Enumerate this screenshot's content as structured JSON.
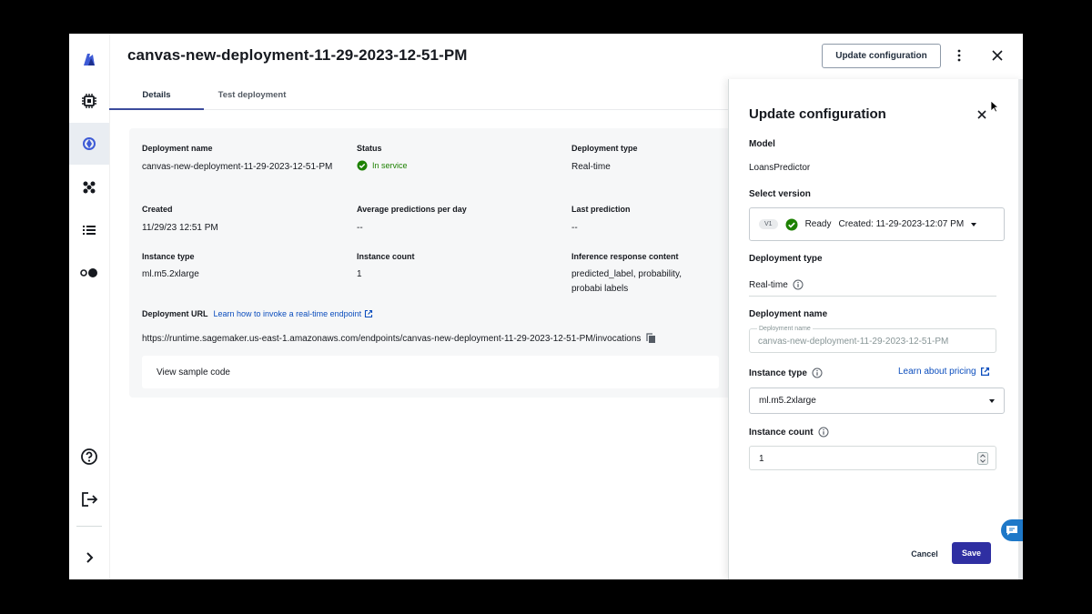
{
  "header": {
    "title": "canvas-new-deployment-11-29-2023-12-51-PM",
    "update_button": "Update configuration"
  },
  "tabs": [
    {
      "label": "Details",
      "active": true
    },
    {
      "label": "Test deployment",
      "active": false
    }
  ],
  "details": {
    "deployment_name": {
      "label": "Deployment name",
      "value": "canvas-new-deployment-11-29-2023-12-51-PM"
    },
    "status": {
      "label": "Status",
      "value": "In service"
    },
    "deployment_type": {
      "label": "Deployment type",
      "value": "Real-time"
    },
    "created": {
      "label": "Created",
      "value": "11/29/23 12:51 PM"
    },
    "avg_predictions": {
      "label": "Average predictions per day",
      "value": "--"
    },
    "last_prediction": {
      "label": "Last prediction",
      "value": "--"
    },
    "instance_type": {
      "label": "Instance type",
      "value": "ml.m5.2xlarge"
    },
    "instance_count": {
      "label": "Instance count",
      "value": "1"
    },
    "inference_content": {
      "label": "Inference response content",
      "value": "predicted_label, probability, probabi labels"
    },
    "deployment_url": {
      "label": "Deployment URL",
      "link": "Learn how to invoke a real-time endpoint",
      "value": "https://runtime.sagemaker.us-east-1.amazonaws.com/endpoints/canvas-new-deployment-11-29-2023-12-51-PM/invocations"
    },
    "sample_code": "View sample code"
  },
  "drawer": {
    "title": "Update configuration",
    "model_label": "Model",
    "model_value": "LoansPredictor",
    "version_label": "Select version",
    "version": {
      "badge": "V1",
      "status": "Ready",
      "created": "Created: 11-29-2023-12:07 PM"
    },
    "deployment_type_label": "Deployment type",
    "deployment_type_value": "Real-time",
    "deployment_name_label": "Deployment name",
    "deployment_name_float": "Deployment name",
    "deployment_name_value": "canvas-new-deployment-11-29-2023-12-51-PM",
    "instance_type_label": "Instance type",
    "pricing_link": "Learn about pricing",
    "instance_type_value": "ml.m5.2xlarge",
    "instance_count_label": "Instance count",
    "instance_count_value": "1",
    "cancel": "Cancel",
    "save": "Save"
  },
  "colors": {
    "accent": "#2f2fa2",
    "success": "#1d8102",
    "link": "#0b4dbd"
  }
}
